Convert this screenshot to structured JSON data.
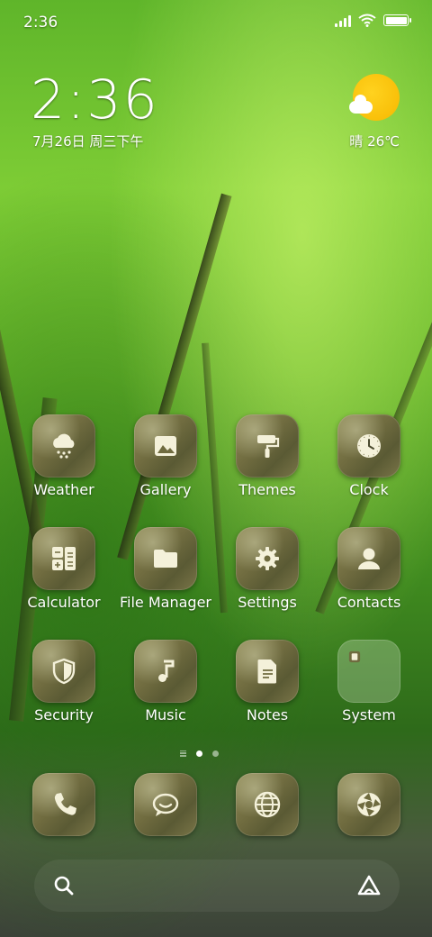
{
  "status_bar": {
    "time": "2:36"
  },
  "clock_widget": {
    "time": "2:36",
    "date": "7月26日 周三下午"
  },
  "weather_widget": {
    "text": "晴 26℃"
  },
  "apps": [
    {
      "label": "Weather",
      "icon": "cloud-snow-icon"
    },
    {
      "label": "Gallery",
      "icon": "image-icon"
    },
    {
      "label": "Themes",
      "icon": "paint-roller-icon"
    },
    {
      "label": "Clock",
      "icon": "clock-icon"
    },
    {
      "label": "Calculator",
      "icon": "calculator-icon"
    },
    {
      "label": "File Manager",
      "icon": "folder-icon"
    },
    {
      "label": "Settings",
      "icon": "gear-icon"
    },
    {
      "label": "Contacts",
      "icon": "person-icon"
    },
    {
      "label": "Security",
      "icon": "shield-icon"
    },
    {
      "label": "Music",
      "icon": "music-note-icon"
    },
    {
      "label": "Notes",
      "icon": "document-icon"
    },
    {
      "label": "System",
      "icon": "folder-grid-icon"
    }
  ],
  "dock": [
    {
      "icon": "phone-icon"
    },
    {
      "icon": "message-icon"
    },
    {
      "icon": "globe-icon"
    },
    {
      "icon": "camera-aperture-icon"
    }
  ],
  "page_indicator": {
    "current": 1,
    "total": 2
  },
  "search_bar": {
    "left_icon": "search-icon",
    "right_icon": "assistant-icon"
  },
  "colors": {
    "sun": "#f6b800",
    "icon_bg": "#6f6b3f",
    "icon_glyph": "#f4f1da"
  }
}
